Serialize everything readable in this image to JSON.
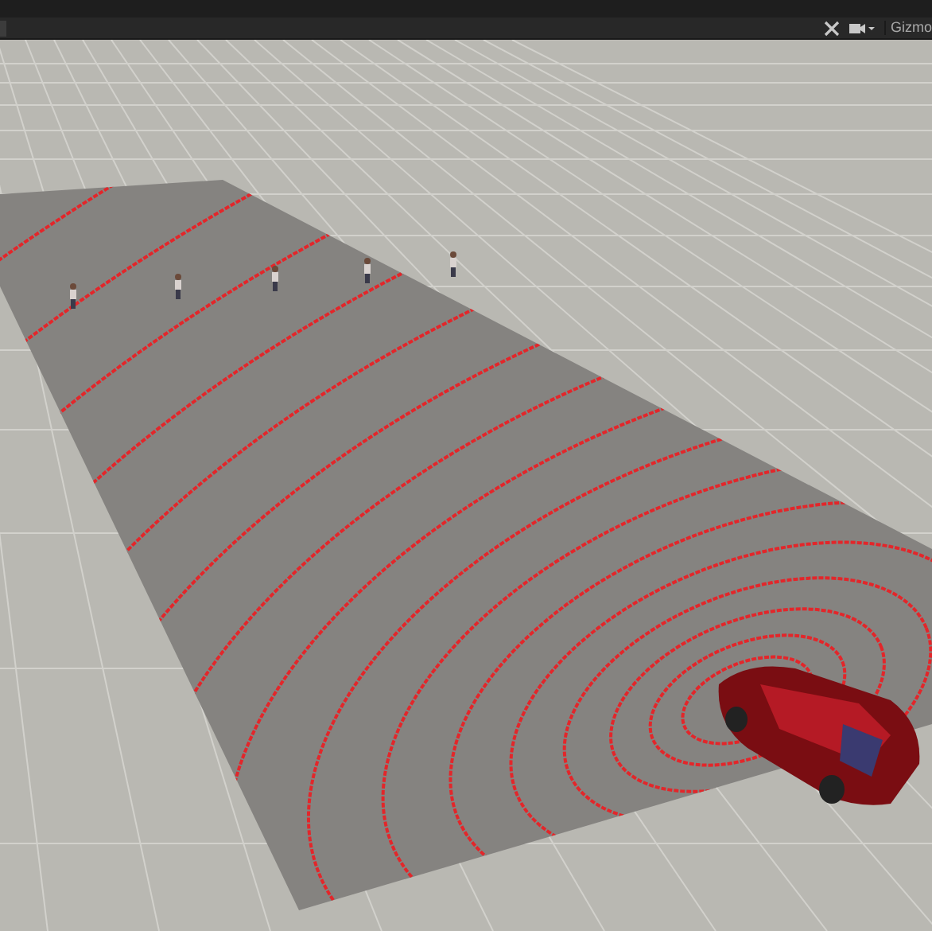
{
  "toolbar": {
    "gizmos_label": "Gizmo"
  }
}
